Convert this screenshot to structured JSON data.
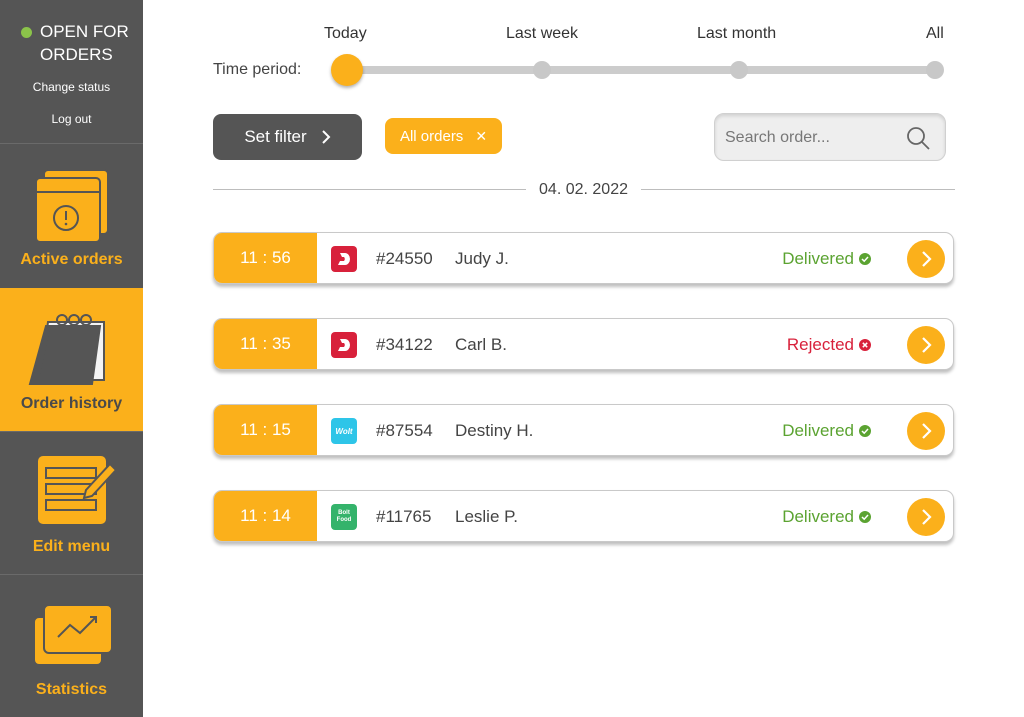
{
  "sidebar": {
    "status_text": "OPEN FOR ORDERS",
    "status_color": "#8bc34a",
    "change_status_label": "Change status",
    "logout_label": "Log out",
    "items": [
      {
        "label": "Active orders",
        "icon": "active-orders-icon",
        "active": false
      },
      {
        "label": "Order history",
        "icon": "calendar-icon",
        "active": true
      },
      {
        "label": "Edit menu",
        "icon": "edit-menu-icon",
        "active": false
      },
      {
        "label": "Statistics",
        "icon": "statistics-icon",
        "active": false
      }
    ]
  },
  "filters": {
    "time_period_label": "Time period:",
    "periods": [
      "Today",
      "Last week",
      "Last month",
      "All"
    ],
    "selected_period": "Today",
    "set_filter_label": "Set filter",
    "chip_label": "All orders",
    "search_placeholder": "Search order..."
  },
  "date_heading": "04. 02. 2022",
  "orders": [
    {
      "time": "11 : 56",
      "platform": "delivery-d-logo",
      "id": "#24550",
      "name": "Judy J.",
      "status": "Delivered",
      "status_type": "success"
    },
    {
      "time": "11 : 35",
      "platform": "delivery-d-logo",
      "id": "#34122",
      "name": "Carl B.",
      "status": "Rejected",
      "status_type": "error"
    },
    {
      "time": "11 : 15",
      "platform": "wolt-logo",
      "id": "#87554",
      "name": "Destiny H.",
      "status": "Delivered",
      "status_type": "success"
    },
    {
      "time": "11 : 14",
      "platform": "bolt-food-logo",
      "id": "#11765",
      "name": "Leslie P.",
      "status": "Delivered",
      "status_type": "success"
    }
  ],
  "logo_text": {
    "wolt": "Wolt",
    "bolt_line1": "Bolt",
    "bolt_line2": "Food"
  },
  "colors": {
    "accent": "#fbb01b",
    "sidebar": "#555555",
    "success": "#5ba331",
    "error": "#d8213b",
    "wolt": "#2ec5e8",
    "bolt": "#34b36b",
    "d_logo": "#d8213b"
  }
}
